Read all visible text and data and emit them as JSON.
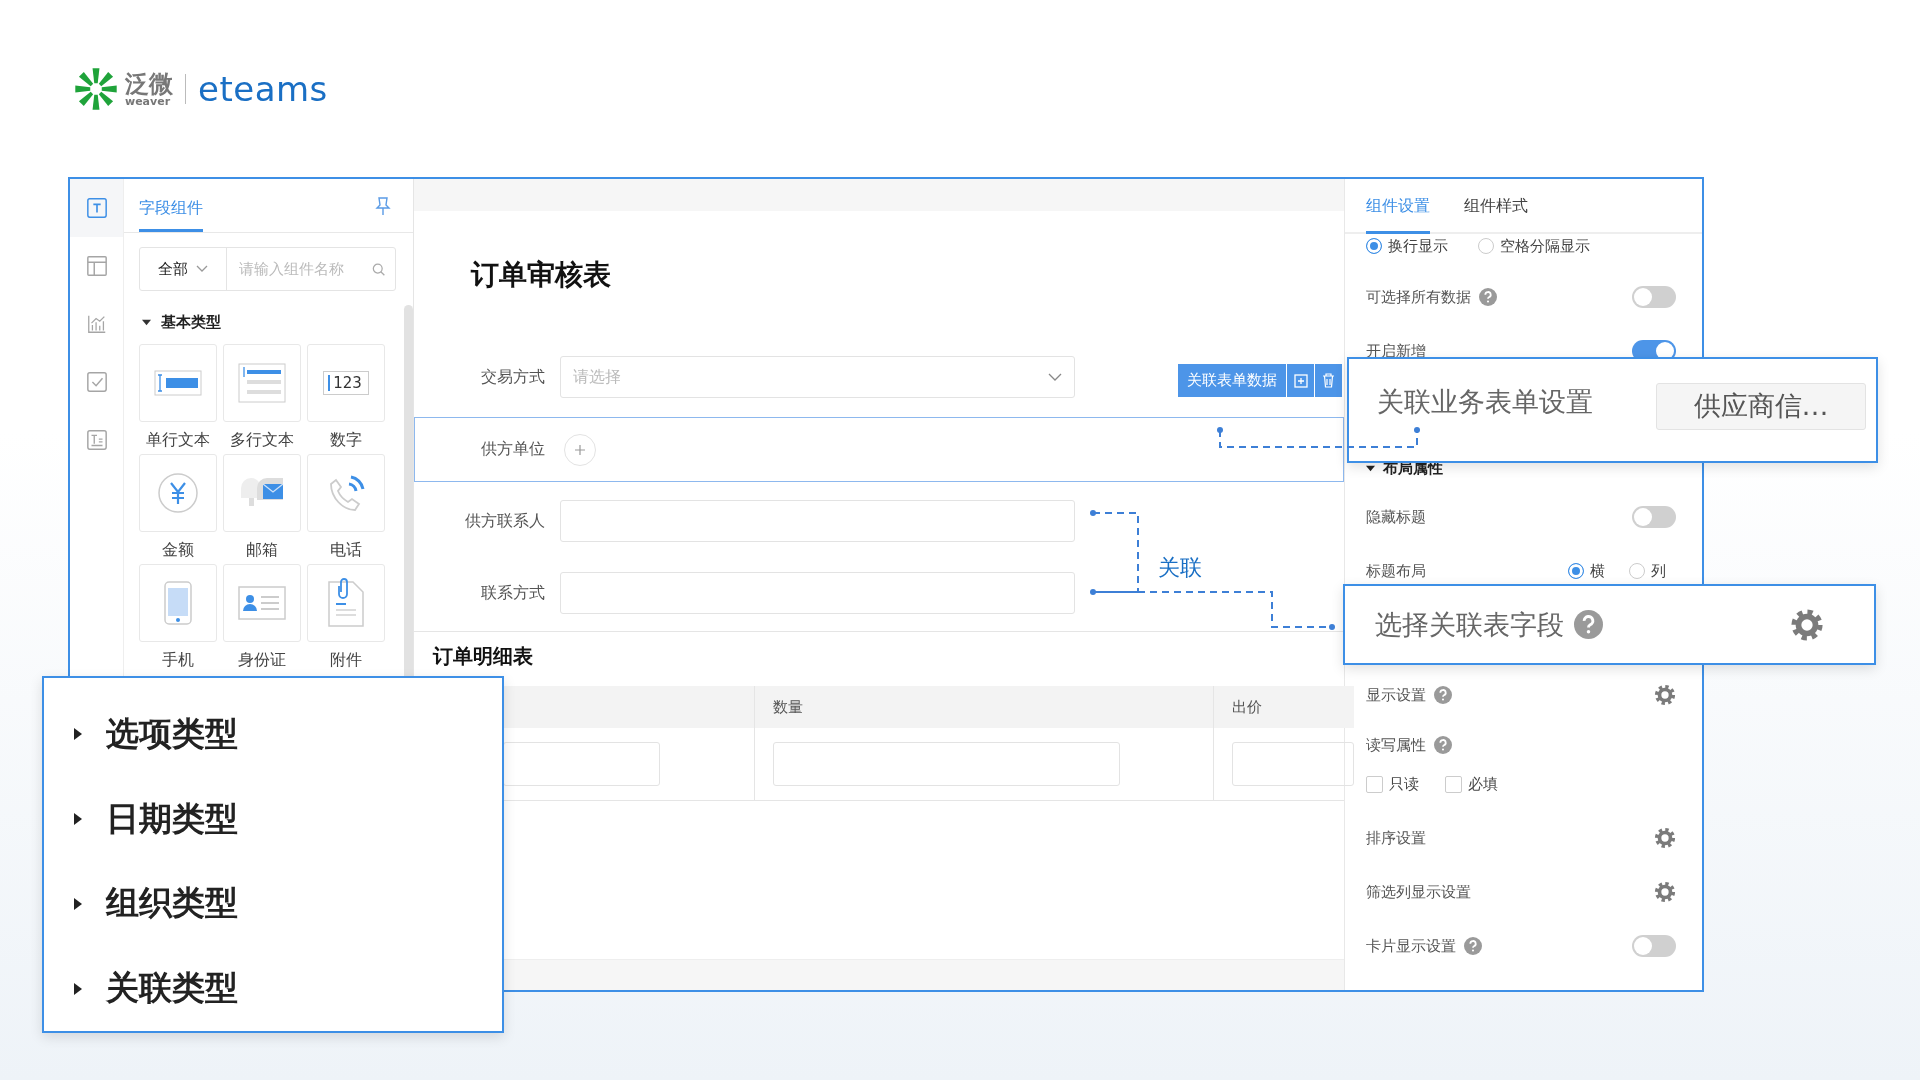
{
  "logo": {
    "brand_cn": "泛微",
    "brand_en": "weaver",
    "product": "eteams"
  },
  "rail": [
    {
      "kind": "text",
      "selected": true
    },
    {
      "kind": "layout",
      "selected": false
    },
    {
      "kind": "chart",
      "selected": false
    },
    {
      "kind": "check",
      "selected": false
    },
    {
      "kind": "doc",
      "selected": false
    }
  ],
  "component_panel": {
    "number_icon_text": "123",
    "tab": "字段组件",
    "filter": "全部",
    "search_placeholder": "请输入组件名称",
    "section": {
      "title": "基本类型",
      "expanded": true,
      "items": [
        {
          "label": "单行文本",
          "kind": "single-line"
        },
        {
          "label": "多行文本",
          "kind": "multi-line"
        },
        {
          "label": "数字",
          "kind": "number"
        },
        {
          "label": "金额",
          "kind": "amount"
        },
        {
          "label": "邮箱",
          "kind": "email"
        },
        {
          "label": "电话",
          "kind": "phone"
        },
        {
          "label": "手机",
          "kind": "mobile"
        },
        {
          "label": "身份证",
          "kind": "id-card"
        },
        {
          "label": "附件",
          "kind": "attachment"
        }
      ]
    }
  },
  "form": {
    "title": "订单审核表",
    "fields": [
      {
        "label": "交易方式",
        "kind": "select",
        "placeholder": "请选择",
        "selected": false
      },
      {
        "label": "供方单位",
        "kind": "association",
        "selected": true
      },
      {
        "label": "供方联系人",
        "kind": "input",
        "selected": false
      },
      {
        "label": "联系方式",
        "kind": "input",
        "selected": false
      }
    ],
    "field_toolbar": {
      "label": "关联表单数据"
    },
    "link_label": "关联",
    "detail": {
      "title": "订单明细表",
      "columns": [
        {
          "label": "数量"
        },
        {
          "label": "出价"
        }
      ]
    }
  },
  "settings": {
    "tabs": [
      {
        "label": "组件设置",
        "selected": true
      },
      {
        "label": "组件样式",
        "selected": false
      }
    ],
    "rows": [
      {
        "kind": "radio",
        "options": [
          {
            "label": "换行显示",
            "selected": true
          },
          {
            "label": "空格分隔显示",
            "selected": false
          }
        ]
      },
      {
        "kind": "toggle",
        "label": "可选择所有数据",
        "help": true,
        "on": false
      },
      {
        "kind": "toggle",
        "label": "开启新增",
        "help": false,
        "on": true
      },
      {
        "kind": "section",
        "label": "布局属性",
        "expanded": true
      },
      {
        "kind": "toggle",
        "label": "隐藏标题",
        "help": false,
        "on": false
      },
      {
        "kind": "radio",
        "label": "标题布局",
        "options": [
          {
            "label": "横",
            "selected": true
          },
          {
            "label": "列",
            "selected": false
          }
        ]
      },
      {
        "kind": "gear",
        "label": "显示设置",
        "help": true
      },
      {
        "kind": "label",
        "label": "读写属性",
        "help": true
      },
      {
        "kind": "checkboxes",
        "options": [
          {
            "label": "只读",
            "checked": false
          },
          {
            "label": "必填",
            "checked": false
          }
        ]
      },
      {
        "kind": "gear",
        "label": "排序设置",
        "help": false
      },
      {
        "kind": "gear",
        "label": "筛选列显示设置",
        "help": false
      },
      {
        "kind": "toggle",
        "label": "卡片显示设置",
        "help": true,
        "on": false
      }
    ]
  },
  "callouts": [
    {
      "kind": "form-setting",
      "label": "关联业务表单设置",
      "button": "供应商信…"
    },
    {
      "kind": "field-select",
      "label": "选择关联表字段",
      "help": true
    },
    {
      "kind": "type-list",
      "items": [
        {
          "label": "选项类型",
          "expanded": false
        },
        {
          "label": "日期类型",
          "expanded": false
        },
        {
          "label": "组织类型",
          "expanded": false
        },
        {
          "label": "关联类型",
          "expanded": false
        }
      ]
    }
  ]
}
